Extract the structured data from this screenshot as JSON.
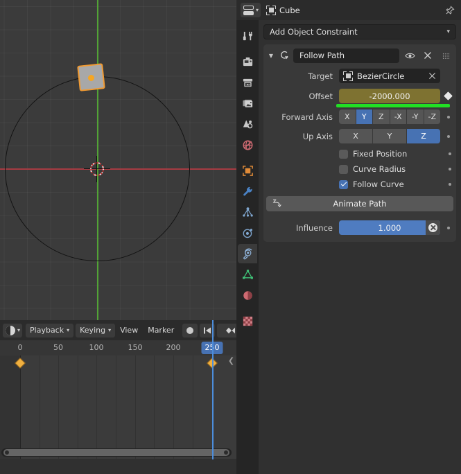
{
  "viewport": {
    "name": "3d-viewport",
    "objects": {
      "cube_label": "Cube",
      "path_label": "BezierCircle"
    },
    "colors": {
      "background": "#3b3b3b",
      "x_axis": "#a63b42",
      "y_axis": "#52a336",
      "object_selected_outline": "#f09a32",
      "object_fill": "#a8a8a8"
    }
  },
  "timeline": {
    "editor_icon": "clock-icon",
    "menus": [
      {
        "label": "Playback",
        "has_dropdown": true
      },
      {
        "label": "Keying",
        "has_dropdown": true
      },
      {
        "label": "View",
        "has_dropdown": false
      },
      {
        "label": "Marker",
        "has_dropdown": false
      }
    ],
    "record_button_icon": "record-dot-icon",
    "jump_start_icon": "jump-to-start-icon",
    "prev_keyframe_icon": "prev-keyframe-icon",
    "ruler_ticks": [
      {
        "label": "0",
        "frame": 0
      },
      {
        "label": "50",
        "frame": 50
      },
      {
        "label": "100",
        "frame": 100
      },
      {
        "label": "150",
        "frame": 150
      },
      {
        "label": "200",
        "frame": 200
      }
    ],
    "current_frame": "250",
    "current_frame_value": 250,
    "keyframes": [
      0,
      250
    ],
    "frame_start": 0,
    "frame_end": 250,
    "region_toggle_icon": "chevron-left-icon",
    "playhead_color": "#4c8ddb",
    "keyframe_color": "#f0b040"
  },
  "properties": {
    "header": {
      "editor_type_icon": "properties-editor-icon",
      "breadcrumb_icon": "object-icon",
      "object_name": "Cube",
      "pin_icon": "pin-icon"
    },
    "tabs": [
      {
        "name": "tool",
        "icon": "tool-icon",
        "active": false
      },
      {
        "name": "render",
        "icon": "render-camera-icon",
        "active": false
      },
      {
        "name": "output",
        "icon": "output-printer-icon",
        "active": false
      },
      {
        "name": "view-layer",
        "icon": "view-layer-images-icon",
        "active": false
      },
      {
        "name": "scene",
        "icon": "scene-cone-icon",
        "active": false
      },
      {
        "name": "world",
        "icon": "world-globe-icon",
        "active": false
      },
      {
        "name": "object",
        "icon": "object-square-icon",
        "active": false
      },
      {
        "name": "modifiers",
        "icon": "wrench-icon",
        "active": false
      },
      {
        "name": "particles",
        "icon": "particles-icon",
        "active": false
      },
      {
        "name": "physics",
        "icon": "physics-orbit-icon",
        "active": false
      },
      {
        "name": "object-constraints",
        "icon": "constraint-icon",
        "active": true
      },
      {
        "name": "object-data",
        "icon": "mesh-data-icon",
        "active": false
      },
      {
        "name": "material",
        "icon": "material-sphere-icon",
        "active": false
      },
      {
        "name": "texture",
        "icon": "texture-checker-icon",
        "active": false
      }
    ],
    "add_constraint": {
      "label": "Add Object Constraint",
      "dropdown_icon": "chevron-down-icon"
    },
    "constraint": {
      "expand_icon": "triangle-down-icon",
      "type_icon": "follow-path-icon",
      "name": "Follow Path",
      "visibility_icon": "eye-icon",
      "delete_icon": "x-icon",
      "grip_icon": "drag-dots-icon",
      "target": {
        "label": "Target",
        "value_icon": "object-icon",
        "value": "BezierCircle",
        "clear_icon": "x-icon"
      },
      "offset": {
        "label": "Offset",
        "value": "-2000.000",
        "animated": true,
        "decorator_icon": "keyframe-diamond-icon",
        "field_color": "#7e7231",
        "anim_bar_color": "#21e024"
      },
      "forward_axis": {
        "label": "Forward Axis",
        "options": [
          "X",
          "Y",
          "Z",
          "-X",
          "-Y",
          "-Z"
        ],
        "selected": "Y",
        "decorator_icon": "animate-dot-icon"
      },
      "up_axis": {
        "label": "Up Axis",
        "options": [
          "X",
          "Y",
          "Z"
        ],
        "selected": "Z",
        "decorator_icon": "animate-dot-icon"
      },
      "fixed_position": {
        "label": "Fixed Position",
        "checked": false,
        "decorator_icon": "animate-dot-icon"
      },
      "curve_radius": {
        "label": "Curve Radius",
        "checked": false,
        "decorator_icon": "animate-dot-icon"
      },
      "follow_curve": {
        "label": "Follow Curve",
        "checked": true,
        "decorator_icon": "animate-dot-icon"
      },
      "animate_path": {
        "label": "Animate Path",
        "icon": "animate-path-icon"
      },
      "influence": {
        "label": "Influence",
        "value": "1.000",
        "slider_fill": 1.0,
        "clear_icon": "x-circle-icon",
        "decorator_icon": "animate-dot-icon",
        "field_color": "#4f7cc0"
      }
    }
  }
}
